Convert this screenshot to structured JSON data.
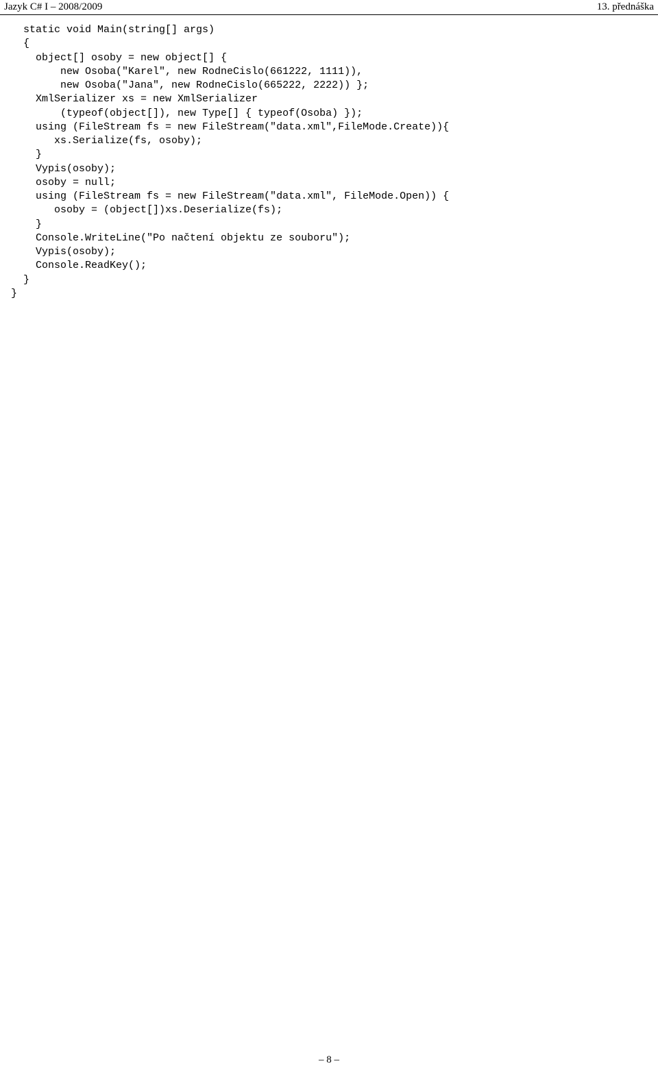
{
  "header": {
    "left": "Jazyk C# I – 2008/2009",
    "right": "13. přednáška"
  },
  "code": {
    "lines": [
      "  static void Main(string[] args)",
      "  {",
      "    object[] osoby = new object[] {",
      "        new Osoba(\"Karel\", new RodneCislo(661222, 1111)),",
      "        new Osoba(\"Jana\", new RodneCislo(665222, 2222)) };",
      "    XmlSerializer xs = new XmlSerializer",
      "        (typeof(object[]), new Type[] { typeof(Osoba) });",
      "    using (FileStream fs = new FileStream(\"data.xml\",FileMode.Create)){",
      "       xs.Serialize(fs, osoby);",
      "    }",
      "    Vypis(osoby);",
      "    osoby = null;",
      "    using (FileStream fs = new FileStream(\"data.xml\", FileMode.Open)) {",
      "       osoby = (object[])xs.Deserialize(fs);",
      "    }",
      "    Console.WriteLine(\"Po načtení objektu ze souboru\");",
      "    Vypis(osoby);",
      "    Console.ReadKey();",
      "  }",
      "}"
    ]
  },
  "footer": {
    "page": "– 8 –"
  }
}
